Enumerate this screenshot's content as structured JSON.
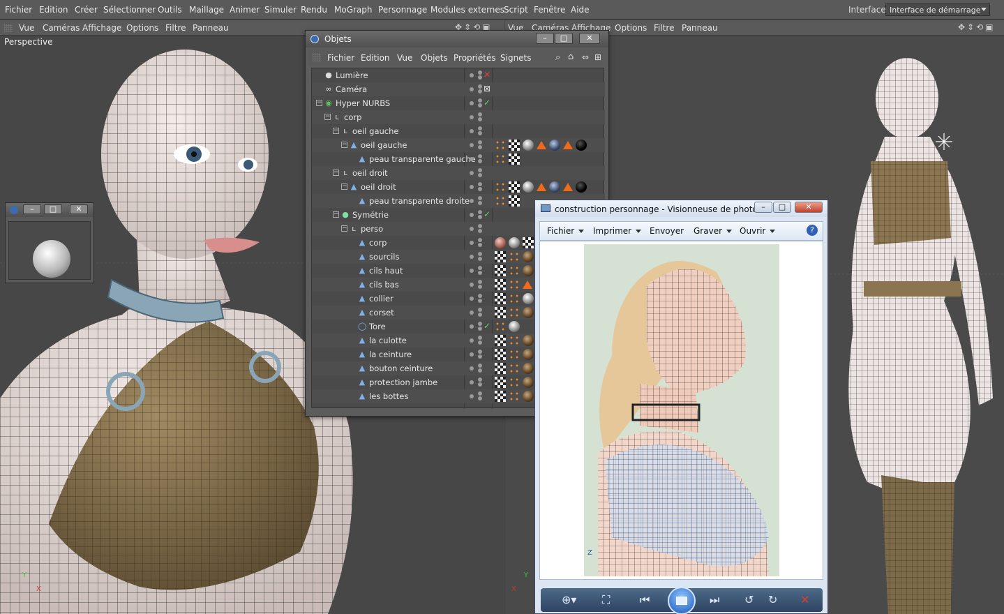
{
  "menubar": {
    "items": [
      "Fichier",
      "Edition",
      "Créer",
      "Sélectionner",
      "Outils",
      "Maillage",
      "Animer",
      "Simuler",
      "Rendu",
      "MoGraph",
      "Personnage",
      "Modules externes",
      "Script",
      "Fenêtre",
      "Aide"
    ],
    "interface_label": "Interface:",
    "interface_value": "Interface de démarrage"
  },
  "viewport_left": {
    "menu": [
      "Vue",
      "Caméras",
      "Affichage",
      "Options",
      "Filtre",
      "Panneau"
    ],
    "label": "Perspective"
  },
  "viewport_right": {
    "menu": [
      "Vue",
      "Caméras",
      "Affichage",
      "Options",
      "Filtre",
      "Panneau"
    ]
  },
  "axes": {
    "x": "X",
    "y": "Y",
    "z": "Z"
  },
  "objects_window": {
    "title": "Objets",
    "menu": [
      "Fichier",
      "Edition",
      "Vue",
      "Objets",
      "Propriétés",
      "Signets"
    ],
    "tree": [
      {
        "label": "Lumière",
        "depth": 0,
        "icon": "light-icon",
        "status": "x"
      },
      {
        "label": "Caméra",
        "depth": 0,
        "icon": "camera-icon",
        "status": "cam"
      },
      {
        "label": "Hyper NURBS",
        "depth": 0,
        "icon": "hypernurbs-icon",
        "status": "check"
      },
      {
        "label": "corp",
        "depth": 1,
        "icon": "null-icon",
        "status": ""
      },
      {
        "label": "oeil gauche",
        "depth": 2,
        "icon": "null-icon",
        "status": ""
      },
      {
        "label": "oeil gauche",
        "depth": 3,
        "icon": "polygon-icon",
        "status": "",
        "tags": [
          "pts",
          "chk",
          "ms",
          "tri",
          "md",
          "tri",
          "mb"
        ]
      },
      {
        "label": "peau transparente gauche",
        "depth": 4,
        "icon": "polygon-icon",
        "status": "",
        "tags": [
          "pts",
          "chk"
        ]
      },
      {
        "label": "oeil droit",
        "depth": 2,
        "icon": "null-icon",
        "status": ""
      },
      {
        "label": "oeil droit",
        "depth": 3,
        "icon": "polygon-icon",
        "status": "",
        "tags": [
          "pts",
          "chk",
          "ms",
          "tri",
          "md",
          "tri",
          "mb"
        ]
      },
      {
        "label": "peau transparente droite",
        "depth": 4,
        "icon": "polygon-icon",
        "status": "",
        "tags": [
          "pts",
          "chk"
        ]
      },
      {
        "label": "Symétrie",
        "depth": 2,
        "icon": "symmetry-icon",
        "status": "check"
      },
      {
        "label": "perso",
        "depth": 3,
        "icon": "null-icon",
        "status": ""
      },
      {
        "label": "corp",
        "depth": 4,
        "icon": "polygon-icon",
        "status": "",
        "tags": [
          "mr",
          "ms",
          "chk"
        ]
      },
      {
        "label": "sourcils",
        "depth": 4,
        "icon": "polygon-icon",
        "status": "",
        "tags": [
          "chk",
          "pts",
          "mbr"
        ]
      },
      {
        "label": "cils haut",
        "depth": 4,
        "icon": "polygon-icon",
        "status": "",
        "tags": [
          "chk",
          "pts",
          "mbr"
        ]
      },
      {
        "label": "cils bas",
        "depth": 4,
        "icon": "polygon-icon",
        "status": "",
        "tags": [
          "chk",
          "pts",
          "tri"
        ]
      },
      {
        "label": "collier",
        "depth": 4,
        "icon": "polygon-icon",
        "status": "",
        "tags": [
          "chk",
          "pts",
          "ms"
        ]
      },
      {
        "label": "corset",
        "depth": 4,
        "icon": "polygon-icon",
        "status": "",
        "tags": [
          "chk",
          "pts",
          "mbr"
        ]
      },
      {
        "label": "Tore",
        "depth": 4,
        "icon": "torus-icon",
        "status": "check",
        "tags": [
          "pts",
          "ms"
        ]
      },
      {
        "label": "la culotte",
        "depth": 4,
        "icon": "polygon-icon",
        "status": "",
        "tags": [
          "chk",
          "pts",
          "mbr"
        ]
      },
      {
        "label": "la ceinture",
        "depth": 4,
        "icon": "polygon-icon",
        "status": "",
        "tags": [
          "chk",
          "pts",
          "mbr"
        ]
      },
      {
        "label": "bouton ceinture",
        "depth": 4,
        "icon": "polygon-icon",
        "status": "",
        "tags": [
          "chk",
          "pts",
          "mbr"
        ]
      },
      {
        "label": "protection jambe",
        "depth": 4,
        "icon": "polygon-icon",
        "status": "",
        "tags": [
          "chk",
          "pts",
          "mbr"
        ]
      },
      {
        "label": "les bottes",
        "depth": 4,
        "icon": "polygon-icon",
        "status": "",
        "tags": [
          "chk",
          "pts",
          "mbr"
        ]
      }
    ]
  },
  "photo_viewer": {
    "title": "construction personnage - Visionneuse de photos ...",
    "menu": [
      "Fichier",
      "Imprimer",
      "Envoyer",
      "Graver",
      "Ouvrir"
    ],
    "menu_has_arrow": [
      true,
      true,
      false,
      true,
      true
    ],
    "canvas_axis_label": "Z"
  },
  "colors": {
    "app_bg": "#3f3f3f",
    "menubar": "#5a5a5a",
    "skin": "#e8dcd8",
    "corset": "#8a7550",
    "collar": "#8aa6b6",
    "viewer_frame": "#dbe6f2"
  }
}
